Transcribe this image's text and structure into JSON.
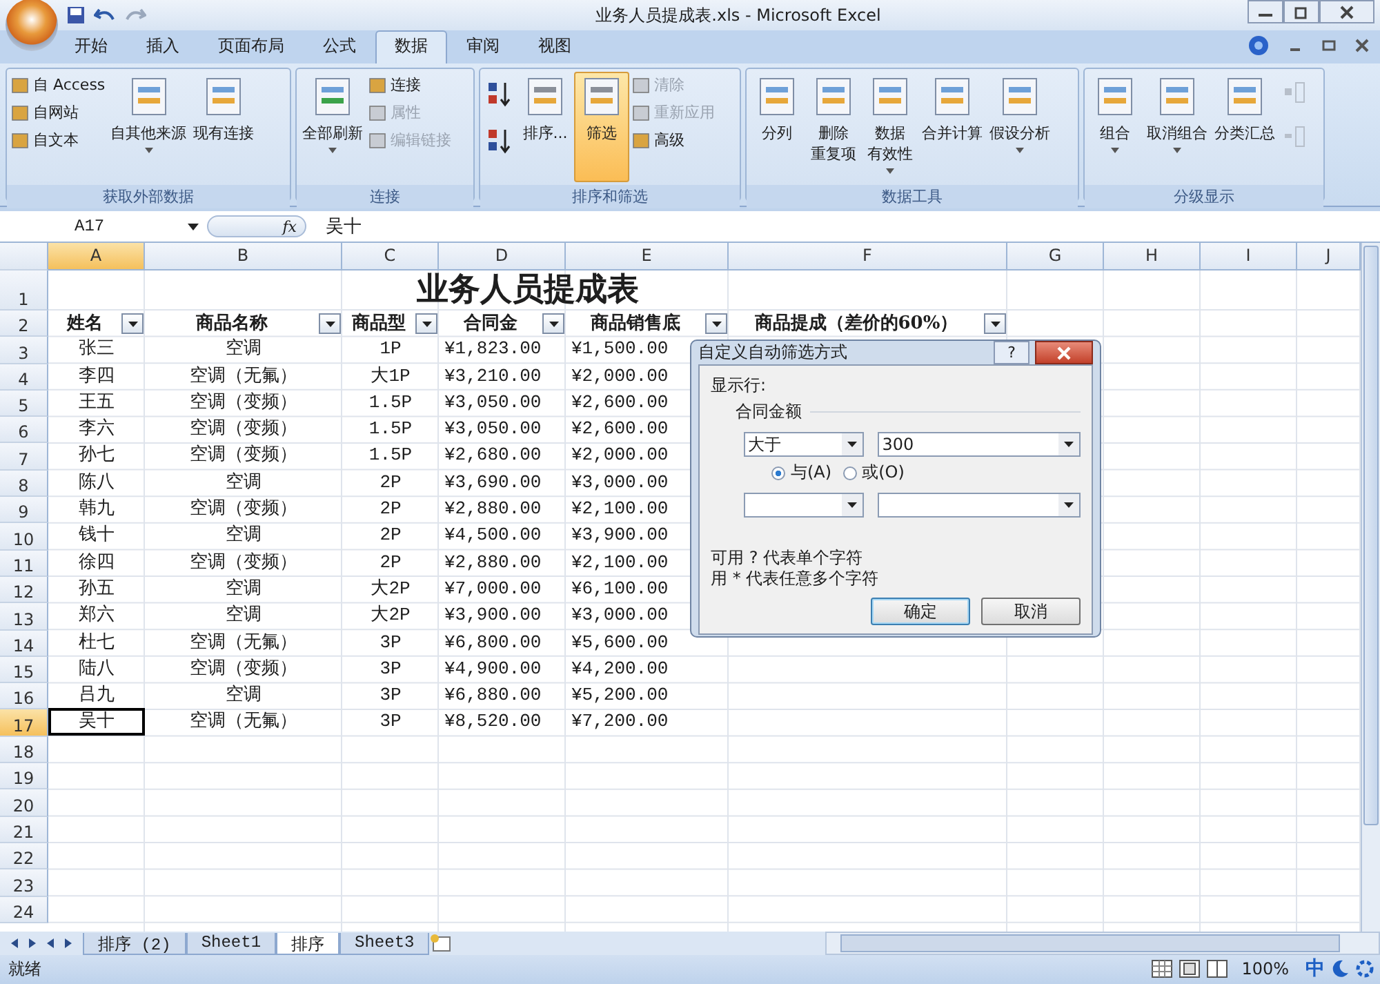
{
  "window": {
    "title": "业务人员提成表.xls - Microsoft Excel"
  },
  "tabs": [
    {
      "label": "开始",
      "selected": false
    },
    {
      "label": "插入",
      "selected": false
    },
    {
      "label": "页面布局",
      "selected": false
    },
    {
      "label": "公式",
      "selected": false
    },
    {
      "label": "数据",
      "selected": true
    },
    {
      "label": "审阅",
      "selected": false
    },
    {
      "label": "视图",
      "selected": false
    }
  ],
  "ribbon_groups": [
    {
      "title": "获取外部数据",
      "items": [
        {
          "kind": "stack",
          "entries": [
            {
              "label": "自 Access",
              "disabled": false
            },
            {
              "label": "自网站",
              "disabled": false
            },
            {
              "label": "自文本",
              "disabled": false
            }
          ]
        },
        {
          "kind": "large",
          "lines": [
            "自其他来源"
          ],
          "dropdown": true,
          "selected": false
        },
        {
          "kind": "large",
          "lines": [
            "现有连接"
          ],
          "dropdown": false,
          "selected": false
        }
      ]
    },
    {
      "title": "连接",
      "items": [
        {
          "kind": "large",
          "lines": [
            "全部刷新"
          ],
          "dropdown": true,
          "selected": false
        },
        {
          "kind": "stack",
          "entries": [
            {
              "label": "连接",
              "disabled": false
            },
            {
              "label": "属性",
              "disabled": true
            },
            {
              "label": "编辑链接",
              "disabled": true
            }
          ]
        }
      ]
    },
    {
      "title": "排序和筛选",
      "items": [
        {
          "kind": "sort"
        },
        {
          "kind": "large",
          "lines": [
            "排序..."
          ],
          "dropdown": false,
          "selected": false
        },
        {
          "kind": "large",
          "lines": [
            "筛选"
          ],
          "dropdown": false,
          "selected": true
        },
        {
          "kind": "stack",
          "entries": [
            {
              "label": "清除",
              "disabled": true
            },
            {
              "label": "重新应用",
              "disabled": true
            },
            {
              "label": "高级",
              "disabled": false
            }
          ]
        }
      ]
    },
    {
      "title": "数据工具",
      "items": [
        {
          "kind": "large",
          "lines": [
            "分列"
          ],
          "dropdown": false,
          "selected": false
        },
        {
          "kind": "large",
          "lines": [
            "删除",
            "重复项"
          ],
          "dropdown": false,
          "selected": false
        },
        {
          "kind": "large",
          "lines": [
            "数据",
            "有效性"
          ],
          "dropdown": true,
          "selected": false
        },
        {
          "kind": "large",
          "lines": [
            "合并计算"
          ],
          "dropdown": false,
          "selected": false
        },
        {
          "kind": "large",
          "lines": [
            "假设分析"
          ],
          "dropdown": true,
          "selected": false
        }
      ]
    },
    {
      "title": "分级显示",
      "items": [
        {
          "kind": "large",
          "lines": [
            "组合"
          ],
          "dropdown": true,
          "selected": false
        },
        {
          "kind": "large",
          "lines": [
            "取消组合"
          ],
          "dropdown": true,
          "selected": false
        },
        {
          "kind": "large",
          "lines": [
            "分类汇总"
          ],
          "dropdown": false,
          "selected": false
        },
        {
          "kind": "outline"
        }
      ]
    }
  ],
  "formula_bar": {
    "name_box": "A17",
    "fx": "fx",
    "value": "吴十"
  },
  "columns": [
    {
      "label": "A",
      "selected": true
    },
    {
      "label": "B",
      "selected": false
    },
    {
      "label": "C",
      "selected": false
    },
    {
      "label": "D",
      "selected": false
    },
    {
      "label": "E",
      "selected": false
    },
    {
      "label": "F",
      "selected": false
    },
    {
      "label": "G",
      "selected": false
    },
    {
      "label": "H",
      "selected": false
    },
    {
      "label": "I",
      "selected": false
    },
    {
      "label": "J",
      "selected": false
    }
  ],
  "sheet_title": {
    "row": "1",
    "text": "业务人员提成表"
  },
  "header_row": {
    "row": "2",
    "cells": [
      "姓名",
      "商品名称",
      "商品型",
      "合同金",
      "商品销售底",
      "商品提成（差价的60%）"
    ]
  },
  "rows": [
    {
      "row": "3",
      "selected": false,
      "cells": [
        "张三",
        "空调",
        "1P",
        "¥1,823.00",
        "¥1,500.00"
      ]
    },
    {
      "row": "4",
      "selected": false,
      "cells": [
        "李四",
        "空调（无氟）",
        "大1P",
        "¥3,210.00",
        "¥2,000.00"
      ]
    },
    {
      "row": "5",
      "selected": false,
      "cells": [
        "王五",
        "空调（变频）",
        "1.5P",
        "¥3,050.00",
        "¥2,600.00"
      ]
    },
    {
      "row": "6",
      "selected": false,
      "cells": [
        "李六",
        "空调（变频）",
        "1.5P",
        "¥3,050.00",
        "¥2,600.00"
      ]
    },
    {
      "row": "7",
      "selected": false,
      "cells": [
        "孙七",
        "空调（变频）",
        "1.5P",
        "¥2,680.00",
        "¥2,000.00"
      ]
    },
    {
      "row": "8",
      "selected": false,
      "cells": [
        "陈八",
        "空调",
        "2P",
        "¥3,690.00",
        "¥3,000.00"
      ]
    },
    {
      "row": "9",
      "selected": false,
      "cells": [
        "韩九",
        "空调（变频）",
        "2P",
        "¥2,880.00",
        "¥2,100.00"
      ]
    },
    {
      "row": "10",
      "selected": false,
      "cells": [
        "钱十",
        "空调",
        "2P",
        "¥4,500.00",
        "¥3,900.00"
      ]
    },
    {
      "row": "11",
      "selected": false,
      "cells": [
        "徐四",
        "空调（变频）",
        "2P",
        "¥2,880.00",
        "¥2,100.00"
      ]
    },
    {
      "row": "12",
      "selected": false,
      "cells": [
        "孙五",
        "空调",
        "大2P",
        "¥7,000.00",
        "¥6,100.00"
      ]
    },
    {
      "row": "13",
      "selected": false,
      "cells": [
        "郑六",
        "空调",
        "大2P",
        "¥3,900.00",
        "¥3,000.00"
      ]
    },
    {
      "row": "14",
      "selected": false,
      "cells": [
        "杜七",
        "空调（无氟）",
        "3P",
        "¥6,800.00",
        "¥5,600.00"
      ]
    },
    {
      "row": "15",
      "selected": false,
      "cells": [
        "陆八",
        "空调（变频）",
        "3P",
        "¥4,900.00",
        "¥4,200.00"
      ]
    },
    {
      "row": "16",
      "selected": false,
      "cells": [
        "吕九",
        "空调",
        "3P",
        "¥6,880.00",
        "¥5,200.00"
      ]
    },
    {
      "row": "17",
      "selected": true,
      "cells": [
        "吴十",
        "空调（无氟）",
        "3P",
        "¥8,520.00",
        "¥7,200.00"
      ]
    },
    {
      "row": "18",
      "selected": false,
      "cells": []
    },
    {
      "row": "19",
      "selected": false,
      "cells": []
    },
    {
      "row": "20",
      "selected": false,
      "cells": []
    },
    {
      "row": "21",
      "selected": false,
      "cells": []
    },
    {
      "row": "22",
      "selected": false,
      "cells": []
    },
    {
      "row": "23",
      "selected": false,
      "cells": []
    },
    {
      "row": "24",
      "selected": false,
      "cells": []
    }
  ],
  "sheet_tabs": [
    {
      "label": "排序 (2)",
      "selected": false
    },
    {
      "label": "Sheet1",
      "selected": false
    },
    {
      "label": "排序",
      "selected": true
    },
    {
      "label": "Sheet3",
      "selected": false
    }
  ],
  "status_bar": {
    "text": "就绪",
    "zoom": "100%",
    "ime": "中"
  },
  "dialog": {
    "title": "自定义自动筛选方式",
    "help": "?",
    "show_rows": "显示行:",
    "field": "合同金额",
    "condition1": {
      "operator": "大于",
      "value": "300"
    },
    "logic": [
      {
        "label": "与(A)",
        "selected": true
      },
      {
        "label": "或(O)",
        "selected": false
      }
    ],
    "hints": [
      "可用 ? 代表单个字符",
      "用 * 代表任意多个字符"
    ],
    "buttons": [
      {
        "label": "确定",
        "default": true
      },
      {
        "label": "取消",
        "default": false
      }
    ]
  }
}
